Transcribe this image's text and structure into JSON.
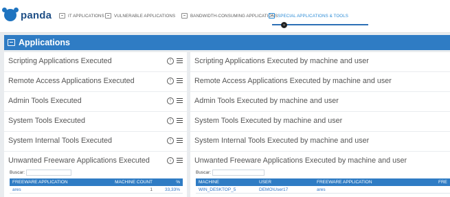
{
  "brand": {
    "name": "panda",
    "color": "#1f74c0"
  },
  "tabs": [
    {
      "label": "IT APPLICATIONS",
      "active": false
    },
    {
      "label": "VULNERABLE APPLICATIONS",
      "active": false
    },
    {
      "label": "BANDWIDTH-CONSUMING APPLICATIONS",
      "active": false
    },
    {
      "label": "SPECIAL APPLICATIONS & TOOLS",
      "active": true
    }
  ],
  "section": {
    "title": "Applications",
    "accent": "#2f7cc4"
  },
  "rows": [
    {
      "left": "Scripting Applications Executed",
      "right": "Scripting Applications Executed by machine and user",
      "toggle": "up-arrow-circle-icon"
    },
    {
      "left": "Remote Access Applications Executed",
      "right": "Remote Access Applications Executed by machine and user",
      "toggle": "up-arrow-circle-icon"
    },
    {
      "left": "Admin Tools Executed",
      "right": "Admin Tools Executed by machine and user",
      "toggle": "up-arrow-circle-icon"
    },
    {
      "left": "System Tools Executed",
      "right": "System Tools Executed by machine and user",
      "toggle": "up-arrow-circle-icon"
    },
    {
      "left": "System Internal Tools Executed",
      "right": "System Internal Tools Executed by machine and user",
      "toggle": "up-arrow-circle-icon"
    },
    {
      "left": "Unwanted Freeware Applications Executed",
      "right": "Unwanted Freeware Applications Executed by machine and user",
      "toggle": "down-arrow-circle-icon"
    }
  ],
  "left_table": {
    "search_label": "Buscar:",
    "columns": [
      "FREEWARE APPLICATION",
      "MACHINE COUNT",
      "%"
    ],
    "rows": [
      [
        "ares",
        "1",
        "33,33%"
      ]
    ]
  },
  "right_table": {
    "search_label": "Buscar:",
    "columns": [
      "MACHINE",
      "USER",
      "FREEWARE APPLICATION",
      "FRE"
    ],
    "rows": [
      [
        "WIN_DESKTOP_5",
        "DEMO\\User17",
        "ares",
        ""
      ]
    ]
  }
}
